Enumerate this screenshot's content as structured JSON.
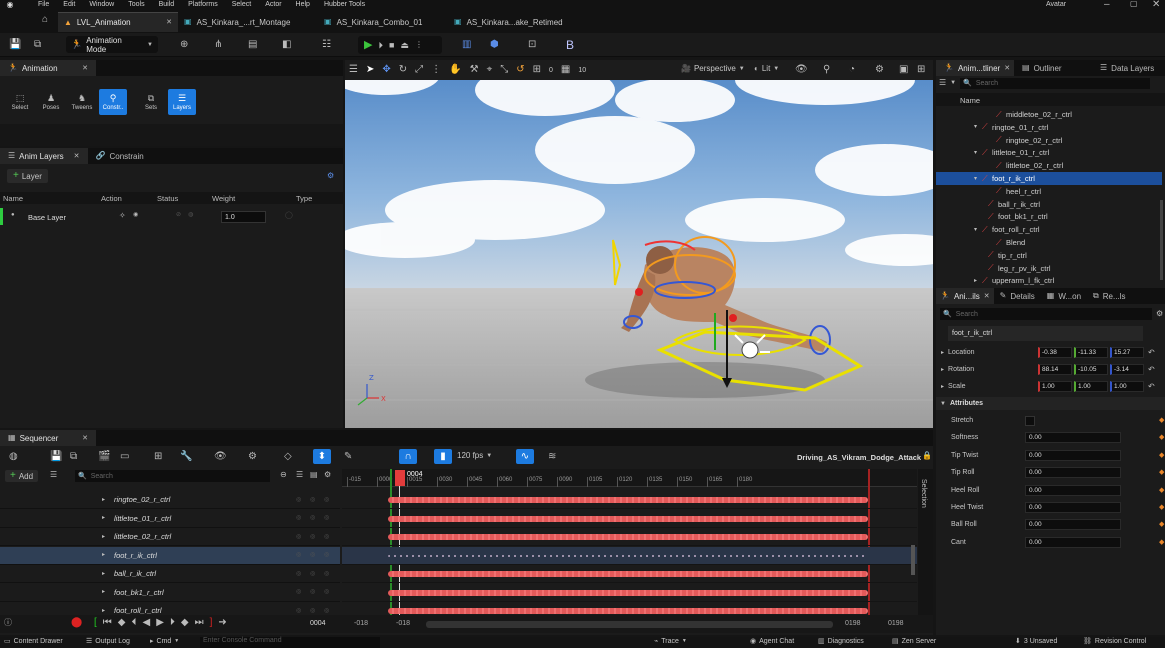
{
  "menu": [
    "File",
    "Edit",
    "Window",
    "Tools",
    "Build",
    "Platforms",
    "Select",
    "Actor",
    "Help",
    "Hubber Tools"
  ],
  "user": "Avatar",
  "doc_tabs": [
    "LVL_Animation",
    "AS_Kinkara_...rt_Montage",
    "AS_Kinkara_Combo_01",
    "AS_Kinkara...ake_Retimed"
  ],
  "toolbar": {
    "mode": "Animation Mode"
  },
  "anim_panel": {
    "title": "Animation",
    "tools": [
      "Select",
      "Poses",
      "Tweens",
      "Constr..",
      "Sets",
      "Layers"
    ]
  },
  "anim_layers": {
    "tabs": [
      "Anim Layers",
      "Constrain"
    ],
    "add_label": "Layer",
    "columns": [
      "Name",
      "Action",
      "Status",
      "Weight",
      "Type"
    ],
    "rows": [
      {
        "name": "Base Layer",
        "weight": "1.0"
      }
    ]
  },
  "viewport": {
    "perspective": "Perspective",
    "lit": "Lit",
    "snap_angle": "0",
    "snap_grid": "10"
  },
  "outliner": {
    "tabs": [
      "Anim...tliner",
      "Outliner",
      "Data Layers"
    ],
    "search_placeholder": "Search",
    "column": "Name",
    "items": [
      {
        "label": "middletoe_02_r_ctrl",
        "indent": 60,
        "arrow": ""
      },
      {
        "label": "ringtoe_01_r_ctrl",
        "indent": 46,
        "arrow": "▾"
      },
      {
        "label": "ringtoe_02_r_ctrl",
        "indent": 60,
        "arrow": ""
      },
      {
        "label": "littletoe_01_r_ctrl",
        "indent": 46,
        "arrow": "▾"
      },
      {
        "label": "littletoe_02_r_ctrl",
        "indent": 60,
        "arrow": ""
      },
      {
        "label": "foot_r_ik_ctrl",
        "indent": 46,
        "arrow": "▾",
        "selected": true
      },
      {
        "label": "heel_r_ctrl",
        "indent": 60,
        "arrow": ""
      },
      {
        "label": "ball_r_ik_ctrl",
        "indent": 52,
        "arrow": ""
      },
      {
        "label": "foot_bk1_r_ctrl",
        "indent": 52,
        "arrow": ""
      },
      {
        "label": "foot_roll_r_ctrl",
        "indent": 46,
        "arrow": "▾"
      },
      {
        "label": "Blend",
        "indent": 60,
        "arrow": ""
      },
      {
        "label": "tip_r_ctrl",
        "indent": 52,
        "arrow": ""
      },
      {
        "label": "leg_r_pv_ik_ctrl",
        "indent": 52,
        "arrow": ""
      },
      {
        "label": "upperarm_l_fk_ctrl",
        "indent": 46,
        "arrow": "▸"
      }
    ]
  },
  "details": {
    "tabs": [
      "Ani...ils",
      "Details",
      "W...on",
      "Re...ls"
    ],
    "search_placeholder": "Search",
    "object": "foot_r_ik_ctrl",
    "location": {
      "label": "Location",
      "x": "-0.38",
      "y": "-11.33",
      "z": "15.27"
    },
    "rotation": {
      "label": "Rotation",
      "x": "88.14",
      "y": "-10.05",
      "z": "-3.14"
    },
    "scale": {
      "label": "Scale",
      "x": "1.00",
      "y": "1.00",
      "z": "1.00"
    },
    "attributes_header": "Attributes",
    "attributes": [
      {
        "label": "Stretch",
        "type": "check"
      },
      {
        "label": "Softness",
        "value": "0.00"
      },
      {
        "label": "Tip Twist",
        "value": "0.00"
      },
      {
        "label": "Tip Roll",
        "value": "0.00"
      },
      {
        "label": "Heel Roll",
        "value": "0.00"
      },
      {
        "label": "Heel Twist",
        "value": "0.00"
      },
      {
        "label": "Ball Roll",
        "value": "0.00"
      },
      {
        "label": "Cant",
        "value": "0.00"
      }
    ]
  },
  "sequencer": {
    "title": "Sequencer",
    "fps": "120 fps",
    "sequence_name": "Driving_AS_Vikram_Dodge_Attack",
    "add_label": "Add",
    "search_placeholder": "Search",
    "current_frame": "0004",
    "frame_field": "0004",
    "range_start": "-018",
    "range_start2": "-018",
    "range_end": "0198",
    "range_end2": "0198",
    "ticks": [
      "-015",
      "0000",
      "0015",
      "0030",
      "0045",
      "0060",
      "0075",
      "0090",
      "0105",
      "0120",
      "0135",
      "0150",
      "0165",
      "0180"
    ],
    "tracks": [
      "ringtoe_02_r_ctrl",
      "littletoe_01_r_ctrl",
      "littletoe_02_r_ctrl",
      "foot_r_ik_ctrl",
      "ball_r_ik_ctrl",
      "foot_bk1_r_ctrl",
      "foot_roll_r_ctrl"
    ],
    "selected_track": 3,
    "selection_label": "Selection"
  },
  "statusbar": {
    "content_drawer": "Content Drawer",
    "output_log": "Output Log",
    "cmd": "Cmd",
    "console_placeholder": "Enter Console Command",
    "trace": "Trace",
    "agent_chat": "Agent Chat",
    "diagnostics": "Diagnostics",
    "zen": "Zen Server",
    "unsaved": "3 Unsaved",
    "revision": "Revision Control"
  },
  "colors": {
    "accent_blue": "#1d7be0",
    "key_red": "#e35a5a",
    "selection_blue": "#1c4f9c"
  }
}
